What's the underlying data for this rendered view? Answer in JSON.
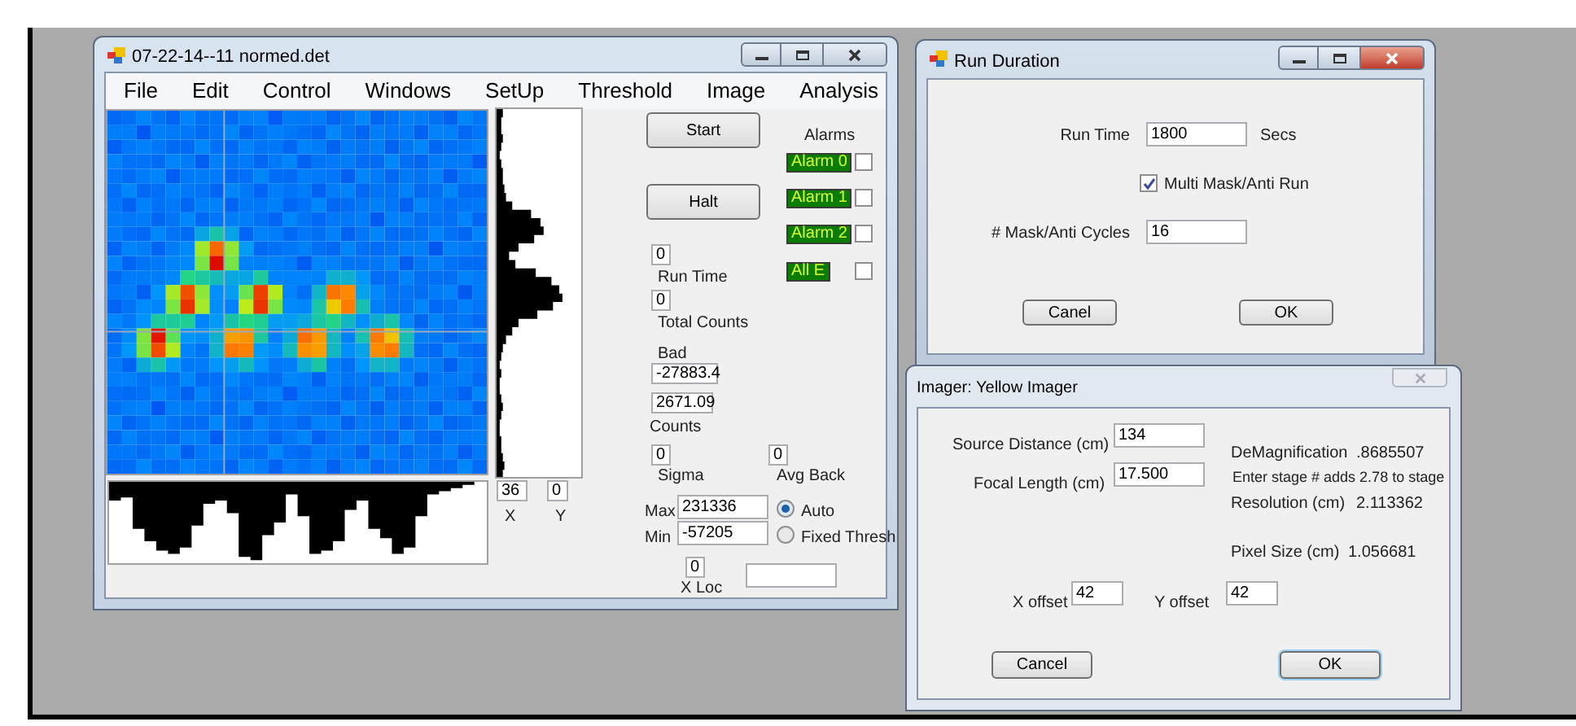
{
  "main_window": {
    "title": "07-22-14--11 normed.det",
    "menu": [
      "File",
      "Edit",
      "Control",
      "Windows",
      "SetUp",
      "Threshold",
      "Image",
      "Analysis"
    ],
    "start_button": "Start",
    "halt_button": "Halt",
    "alarms_label": "Alarms",
    "alarms": [
      {
        "label": "Alarm 0",
        "checked": false
      },
      {
        "label": "Alarm 1",
        "checked": false
      },
      {
        "label": "Alarm 2",
        "checked": false
      },
      {
        "label": "All E",
        "checked": false
      }
    ],
    "x_value": "36",
    "x_label": "X",
    "y_value": "0",
    "y_label": "Y",
    "run_time_value": "0",
    "run_time_label": "Run Time",
    "total_counts_value": "0",
    "total_counts_label": "Total Counts",
    "bad_label": "Bad",
    "bad_value": "-27883.4",
    "counts_value": "2671.09",
    "counts_label": "Counts",
    "sigma_value": "0",
    "sigma_label": "Sigma",
    "avg_back_value": "0",
    "avg_back_label": "Avg Back",
    "max_label": "Max",
    "max_value": "231336",
    "min_label": "Min",
    "min_value": "-57205",
    "threshold_modes": [
      {
        "label": "Auto",
        "selected": true
      },
      {
        "label": "Fixed Thresh",
        "selected": false
      }
    ],
    "x_loc_value": "0",
    "x_loc_label": "X Loc"
  },
  "run_duration": {
    "title": "Run Duration",
    "run_time_label": "Run Time",
    "run_time_value": "1800",
    "unit": "Secs",
    "multi_run": {
      "label": "Multi Mask/Anti Run",
      "checked": true
    },
    "cycles_label": "# Mask/Anti Cycles",
    "cycles_value": "16",
    "cancel_button": "Canel",
    "ok_button": "OK"
  },
  "imager": {
    "title": "Imager: Yellow Imager",
    "source_distance_label": "Source Distance (cm)",
    "source_distance_value": "134",
    "focal_length_label": "Focal Length (cm)",
    "focal_length_value": "17.500",
    "demagnification_label": "DeMagnification",
    "demagnification_value": ".8685507",
    "stage_note": "Enter stage # adds 2.78 to stage",
    "resolution_label": "Resolution (cm)",
    "resolution_value": "2.113362",
    "pixel_size_label": "Pixel Size (cm)",
    "pixel_size_value": "1.056681",
    "x_offset_label": "X offset",
    "x_offset_value": "42",
    "y_offset_label": "Y offset",
    "y_offset_value": "42",
    "cancel_button": "Cancel",
    "ok_button": "OK"
  }
}
